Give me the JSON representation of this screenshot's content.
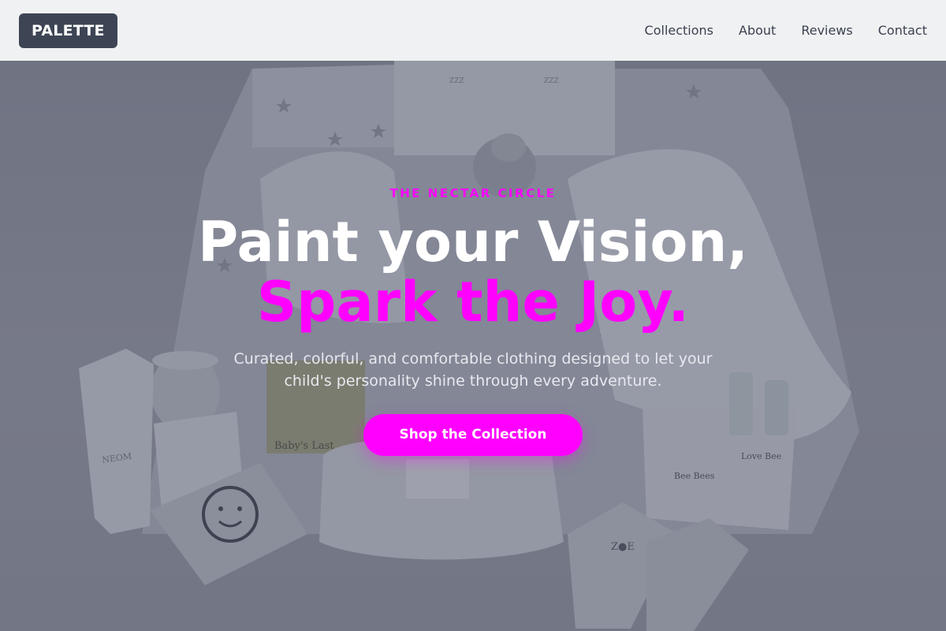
{
  "header": {
    "logo": "PALETTE",
    "nav": [
      "Collections",
      "About",
      "Reviews",
      "Contact"
    ]
  },
  "hero": {
    "eyebrow": "THE NECTAR CIRCLE",
    "headline_line1": "Paint your Vision,",
    "headline_line2": "Spark the Joy.",
    "subtext": "Curated, colorful, and comfortable clothing designed to let your child's personality shine through every adventure.",
    "cta_label": "Shop the Collection",
    "image_labels": {
      "book": "Baby's Last",
      "bee_box": "Bee Bees",
      "love_bee": "Love Bee",
      "neom": "NEOM",
      "zoe": "Z●E"
    }
  },
  "colors": {
    "accent": "#ff00ff",
    "logo_bg": "#3d4554",
    "header_bg": "#f0f1f2",
    "nav_text": "#3a4150"
  }
}
